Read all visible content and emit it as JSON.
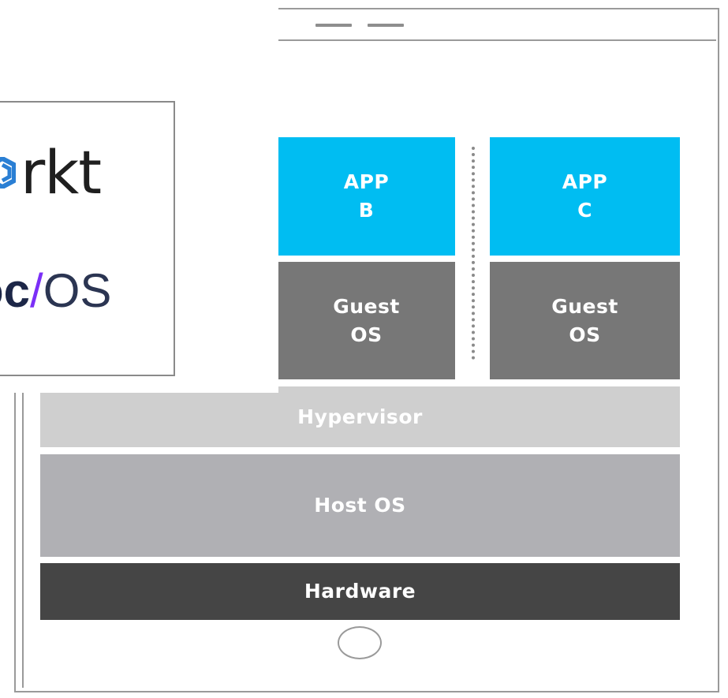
{
  "diagram": {
    "apps": [
      {
        "line1": "APP",
        "line2": "B"
      },
      {
        "line1": "APP",
        "line2": "C"
      }
    ],
    "guest_os": [
      {
        "line1": "Guest",
        "line2": "OS"
      },
      {
        "line1": "Guest",
        "line2": "OS"
      }
    ],
    "hypervisor": "Hypervisor",
    "host_os": "Host OS",
    "hardware": "Hardware",
    "colors": {
      "app": "#00bdf2",
      "guest_os": "#777777",
      "hypervisor": "#cfcfcf",
      "host_os": "#b0b0b4",
      "hardware": "#454545",
      "frame": "#9a9a9a"
    }
  },
  "logos": {
    "rkt_icon": "rkt-logo-icon",
    "rkt_text": "rkt",
    "coreos_core": "oc",
    "coreos_slash": "/",
    "coreos_os": "OS",
    "colors": {
      "rkt_icon": "#2a7fd4",
      "coreos_slash": "#7b2ff7"
    }
  }
}
